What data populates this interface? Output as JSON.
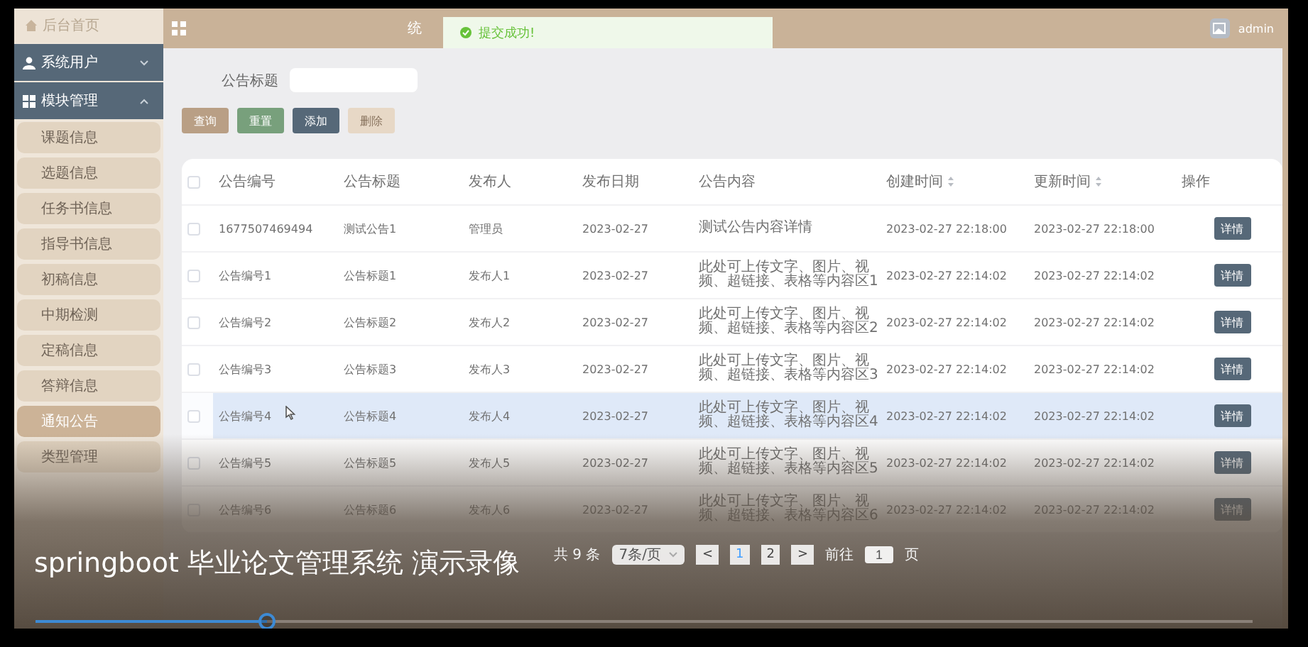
{
  "sidebar": {
    "home": {
      "label": "后台首页"
    },
    "groups": [
      {
        "label": "系统用户",
        "expanded": false
      },
      {
        "label": "模块管理",
        "expanded": true,
        "items": [
          {
            "label": "课题信息",
            "selected": false
          },
          {
            "label": "选题信息",
            "selected": false
          },
          {
            "label": "任务书信息",
            "selected": false
          },
          {
            "label": "指导书信息",
            "selected": false
          },
          {
            "label": "初稿信息",
            "selected": false
          },
          {
            "label": "中期检测",
            "selected": false
          },
          {
            "label": "定稿信息",
            "selected": false
          },
          {
            "label": "答辩信息",
            "selected": false
          },
          {
            "label": "通知公告",
            "selected": true
          },
          {
            "label": "类型管理",
            "selected": false
          }
        ]
      }
    ]
  },
  "header": {
    "title": "统",
    "user": "admin"
  },
  "toast": {
    "message": "提交成功!"
  },
  "search": {
    "label": "公告标题"
  },
  "buttons": [
    {
      "label": "查询",
      "kind": "query",
      "disabled": false
    },
    {
      "label": "重置",
      "kind": "reset",
      "disabled": false
    },
    {
      "label": "添加",
      "kind": "add",
      "disabled": false
    },
    {
      "label": "删除",
      "kind": "delete",
      "disabled": true
    }
  ],
  "table": {
    "all_checked": false,
    "columns": [
      {
        "label": "公告编号",
        "sortable": false
      },
      {
        "label": "公告标题",
        "sortable": false
      },
      {
        "label": "发布人",
        "sortable": false
      },
      {
        "label": "发布日期",
        "sortable": false
      },
      {
        "label": "公告内容",
        "sortable": false
      },
      {
        "label": "创建时间",
        "sortable": true
      },
      {
        "label": "更新时间",
        "sortable": true
      },
      {
        "label": "操作",
        "sortable": false
      }
    ],
    "rows": [
      {
        "checked": false,
        "highlighted": false,
        "cells": [
          "1677507469494",
          "测试公告1",
          "管理员",
          "2023-02-27",
          "测试公告内容详情",
          "2023-02-27 22:18:00",
          "2023-02-27 22:18:00"
        ],
        "action": "详情"
      },
      {
        "checked": false,
        "highlighted": false,
        "cells": [
          "公告编号1",
          "公告标题1",
          "发布人1",
          "2023-02-27",
          "此处可上传文字、图片、视频、超链接、表格等内容区1",
          "2023-02-27 22:14:02",
          "2023-02-27 22:14:02"
        ],
        "action": "详情"
      },
      {
        "checked": false,
        "highlighted": false,
        "cells": [
          "公告编号2",
          "公告标题2",
          "发布人2",
          "2023-02-27",
          "此处可上传文字、图片、视频、超链接、表格等内容区2",
          "2023-02-27 22:14:02",
          "2023-02-27 22:14:02"
        ],
        "action": "详情"
      },
      {
        "checked": false,
        "highlighted": false,
        "cells": [
          "公告编号3",
          "公告标题3",
          "发布人3",
          "2023-02-27",
          "此处可上传文字、图片、视频、超链接、表格等内容区3",
          "2023-02-27 22:14:02",
          "2023-02-27 22:14:02"
        ],
        "action": "详情"
      },
      {
        "checked": false,
        "highlighted": true,
        "cells": [
          "公告编号4",
          "公告标题4",
          "发布人4",
          "2023-02-27",
          "此处可上传文字、图片、视频、超链接、表格等内容区4",
          "2023-02-27 22:14:02",
          "2023-02-27 22:14:02"
        ],
        "action": "详情"
      },
      {
        "checked": false,
        "highlighted": false,
        "cells": [
          "公告编号5",
          "公告标题5",
          "发布人5",
          "2023-02-27",
          "此处可上传文字、图片、视频、超链接、表格等内容区5",
          "2023-02-27 22:14:02",
          "2023-02-27 22:14:02"
        ],
        "action": "详情"
      },
      {
        "checked": false,
        "highlighted": false,
        "cells": [
          "公告编号6",
          "公告标题6",
          "发布人6",
          "2023-02-27",
          "此处可上传文字、图片、视频、超链接、表格等内容区6",
          "2023-02-27 22:14:02",
          "2023-02-27 22:14:02"
        ],
        "action": "详情"
      }
    ]
  },
  "pagination": {
    "total": "共 9 条",
    "page_size": "7条/页",
    "prev": "<",
    "pages": [
      {
        "label": "1",
        "selected": true
      },
      {
        "label": "2",
        "selected": false
      }
    ],
    "next": ">",
    "goto": "前往",
    "page_value": "1",
    "suffix": "页"
  },
  "player": {
    "caption": "springboot 毕业论文管理系统 演示录像",
    "level": 0.19
  }
}
